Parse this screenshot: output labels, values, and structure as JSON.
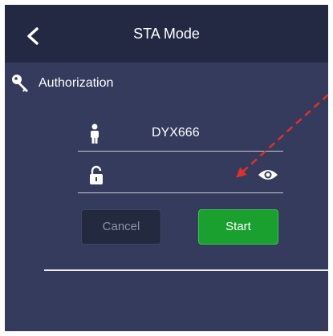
{
  "header": {
    "title": "STA Mode",
    "back_icon": "chevron-left-icon"
  },
  "section": {
    "label": "Authorization",
    "icon": "key-icon"
  },
  "form": {
    "username": {
      "value": "DYX666",
      "icon": "person-icon"
    },
    "password": {
      "value": "",
      "placeholder": "",
      "icon": "lock-icon",
      "toggle_icon": "eye-icon"
    },
    "cancel_label": "Cancel",
    "start_label": "Start"
  },
  "colors": {
    "background": "#343b5c",
    "header": "#232943",
    "start_button": "#1aa02f",
    "cancel_button": "#232a3f",
    "annotation_arrow": "#e0302a"
  }
}
